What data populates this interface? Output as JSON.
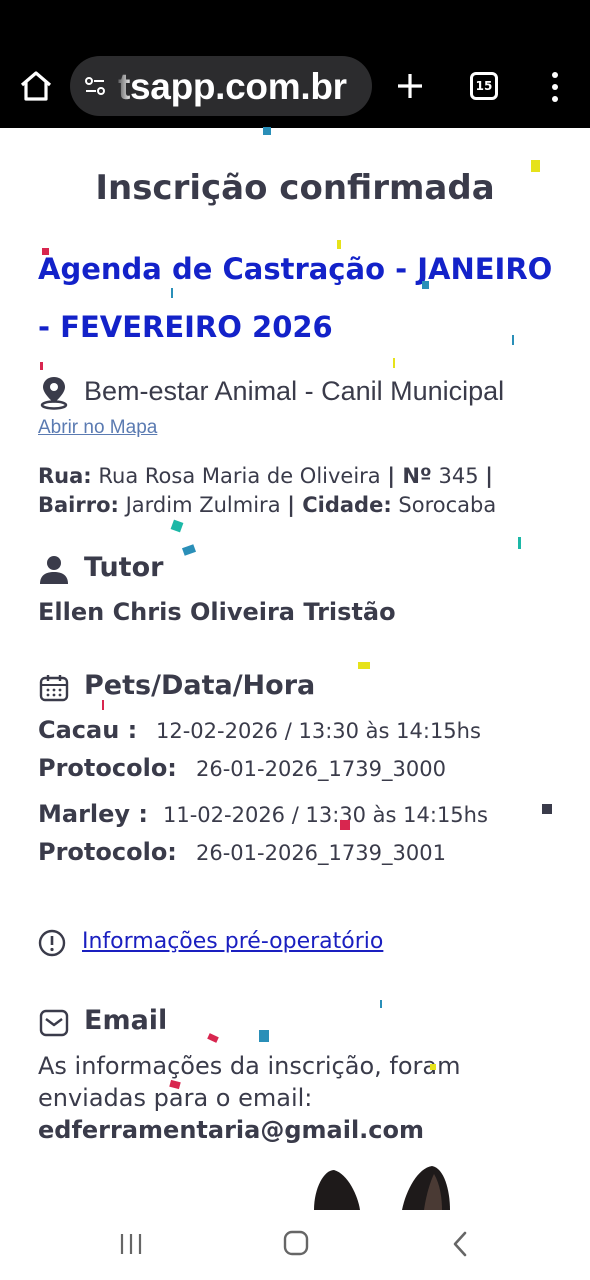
{
  "browser": {
    "url": "tsapp.com.br",
    "tab_count": "15"
  },
  "page": {
    "title": "Inscrição confirmada",
    "event_title": "Agenda de Castração - JANEIRO - FEVEREIRO 2026",
    "location": {
      "name": "Bem-estar Animal - Canil Municipal",
      "map_link": "Abrir no Mapa",
      "street_label": "Rua:",
      "street": "Rua Rosa Maria de Oliveira",
      "number_label": "| Nº",
      "number": "345",
      "neighborhood_label": "| Bairro:",
      "neighborhood": "Jardim Zulmira",
      "city_label": "| Cidade:",
      "city": "Sorocaba"
    },
    "tutor": {
      "heading": "Tutor",
      "name": "Ellen Chris Oliveira Tristão"
    },
    "pets": {
      "heading": "Pets/Data/Hora",
      "protocol_label": "Protocolo:",
      "items": [
        {
          "name": "Cacau :",
          "schedule": "12-02-2026 / 13:30 às 14:15hs",
          "protocol": "26-01-2026_1739_3000"
        },
        {
          "name": "Marley :",
          "schedule": "11-02-2026 / 13:30 às 14:15hs",
          "protocol": "26-01-2026_1739_3001"
        }
      ]
    },
    "preop_link": "Informações pré-operatório",
    "email": {
      "heading": "Email",
      "text": "As informações da inscrição, foram enviadas para o email:",
      "address": "edferramentaria@gmail.com"
    }
  },
  "colors": {
    "heading": "#3a3b4a",
    "event_title": "#1322c9",
    "link": "#1a1fc0",
    "map_link": "#5b7bb2"
  }
}
